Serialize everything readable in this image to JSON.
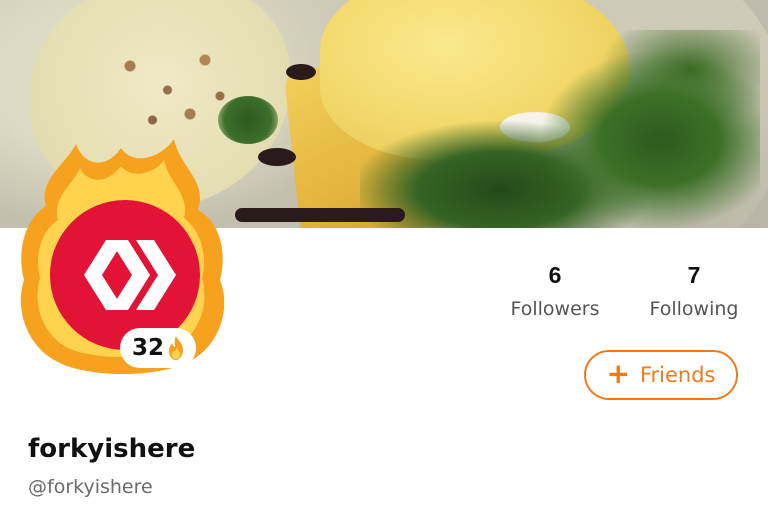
{
  "profile": {
    "display_name": "forkyishere",
    "handle": "@forkyishere",
    "streak_count": "32"
  },
  "stats": {
    "followers_count": "6",
    "followers_label": "Followers",
    "following_count": "7",
    "following_label": "Following"
  },
  "actions": {
    "friends_label": "Friends",
    "plus_glyph": "+"
  },
  "icons": {
    "avatar_logo": "hive-logo-icon",
    "avatar_ring": "flame-ring-icon",
    "streak": "fire-icon",
    "add": "plus-icon"
  },
  "colors": {
    "accent": "#f07a1a",
    "avatar_bg": "#e31337",
    "flame_outer": "#f6a21e",
    "flame_inner": "#ffd34d"
  }
}
